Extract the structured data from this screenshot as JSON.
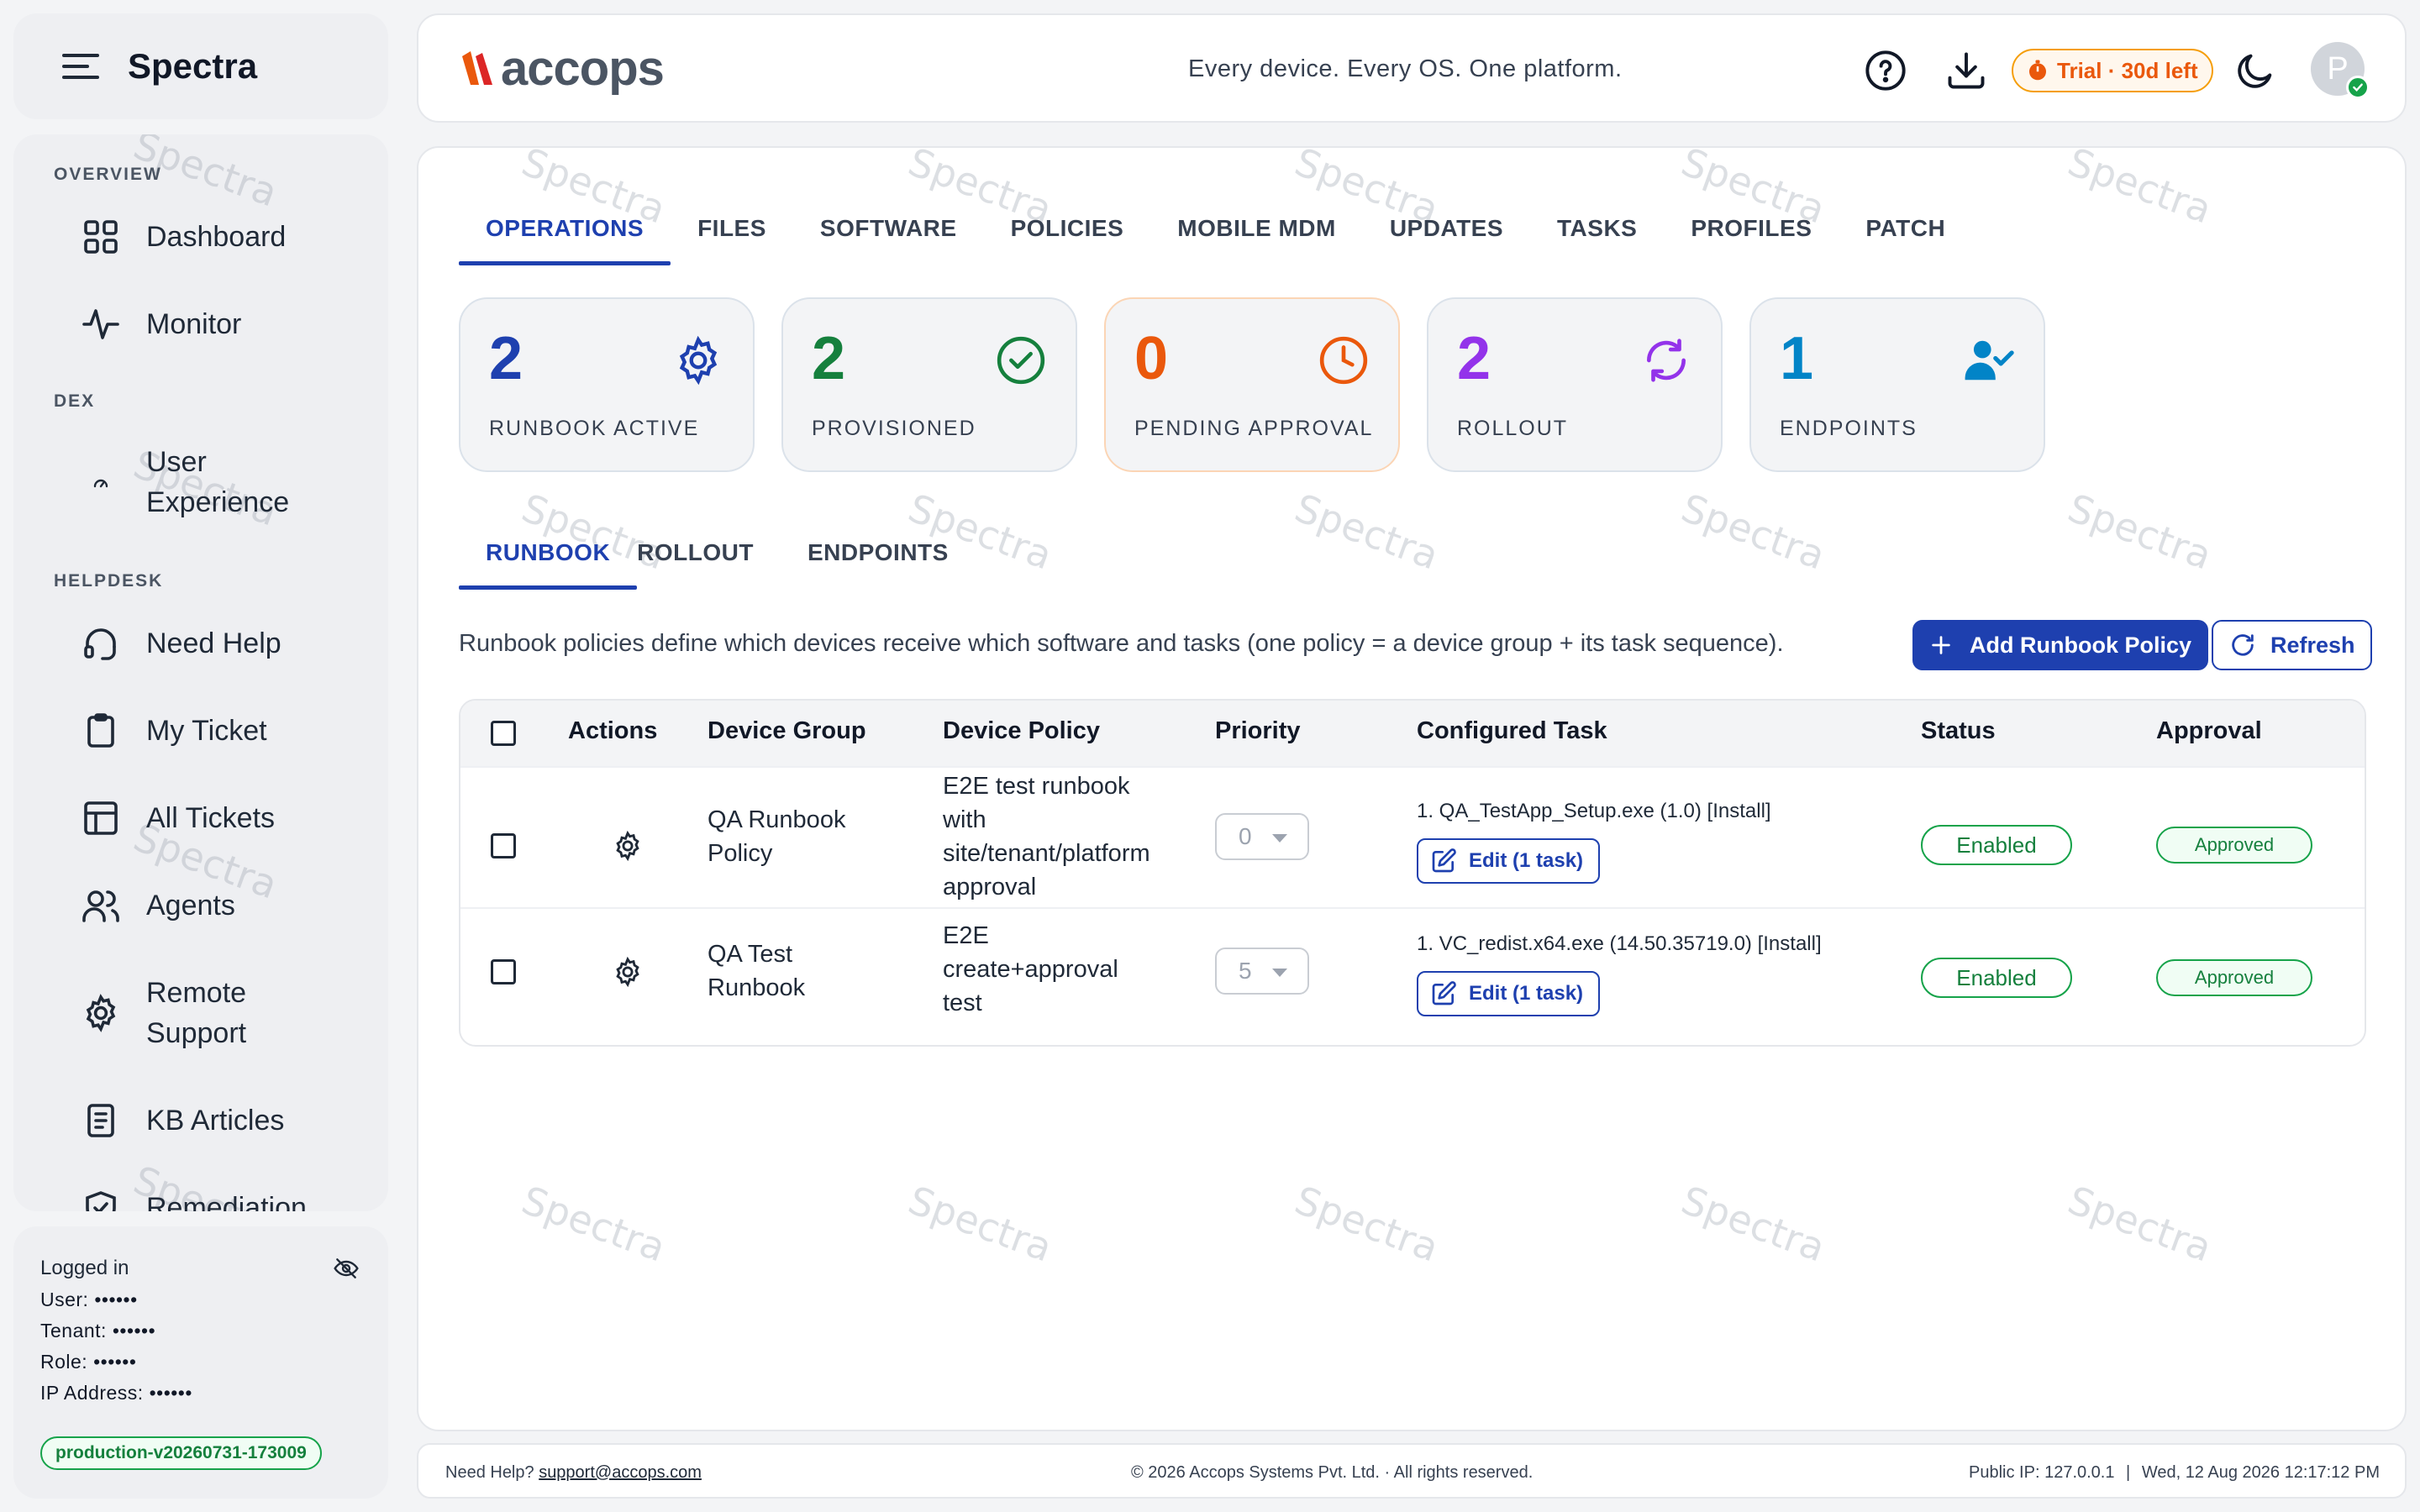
{
  "sidebar": {
    "brand": "Spectra",
    "sections": {
      "overview": "OVERVIEW",
      "dex": "DEX",
      "helpdesk": "HELPDESK"
    },
    "items": {
      "dashboard": "Dashboard",
      "monitor": "Monitor",
      "user_experience_1": "User",
      "user_experience_2": "Experience",
      "need_help": "Need Help",
      "my_ticket": "My Ticket",
      "all_tickets": "All Tickets",
      "agents": "Agents",
      "remote_support_1": "Remote",
      "remote_support_2": "Support",
      "kb_articles": "KB Articles",
      "remediation": "Remediation"
    },
    "login": {
      "title": "Logged in",
      "user": "User: ••••••",
      "tenant": "Tenant: ••••••",
      "role": "Role: ••••••",
      "ip": "IP Address: ••••••",
      "version": "production-v20260731-173009"
    }
  },
  "header": {
    "logo_text": "accops",
    "tagline": "Every device. Every OS. One platform.",
    "trial": "Trial · 30d left",
    "avatar_initial": "P"
  },
  "watermark": "Spectra",
  "tabs": [
    "OPERATIONS",
    "FILES",
    "SOFTWARE",
    "POLICIES",
    "MOBILE MDM",
    "UPDATES",
    "TASKS",
    "PROFILES",
    "PATCH"
  ],
  "stats": [
    {
      "value": "2",
      "label": "RUNBOOK ACTIVE",
      "color": "#1e40af",
      "icon": "gear-icon"
    },
    {
      "value": "2",
      "label": "PROVISIONED",
      "color": "#15803d",
      "icon": "check-circle-icon"
    },
    {
      "value": "0",
      "label": "PENDING APPROVAL",
      "color": "#ea580c",
      "icon": "clock-icon"
    },
    {
      "value": "2",
      "label": "ROLLOUT",
      "color": "#9333ea",
      "icon": "sync-icon"
    },
    {
      "value": "1",
      "label": "ENDPOINTS",
      "color": "#0284c7",
      "icon": "user-check-icon"
    }
  ],
  "subtabs": [
    "RUNBOOK",
    "ROLLOUT",
    "ENDPOINTS"
  ],
  "description": "Runbook policies define which devices receive which software and tasks (one policy = a device group + its task sequence).",
  "buttons": {
    "add": "Add Runbook Policy",
    "refresh": "Refresh"
  },
  "table": {
    "headers": [
      "Actions",
      "Device Group",
      "Device Policy",
      "Priority",
      "Configured Task",
      "Status",
      "Approval"
    ],
    "rows": [
      {
        "group_1": "QA Runbook",
        "group_2": "Policy",
        "policy_1": "E2E test runbook",
        "policy_2": "with",
        "policy_3": "site/tenant/platform",
        "policy_4": "approval",
        "priority": "0",
        "task": "1. QA_TestApp_Setup.exe (1.0) [Install]",
        "edit": "Edit (1 task)",
        "status": "Enabled",
        "approval": "Approved"
      },
      {
        "group_1": "QA Test",
        "group_2": "Runbook",
        "policy_1": "E2E",
        "policy_2": "create+approval",
        "policy_3": "test",
        "priority": "5",
        "task": "1. VC_redist.x64.exe (14.50.35719.0) [Install]",
        "edit": "Edit (1 task)",
        "status": "Enabled",
        "approval": "Approved"
      }
    ]
  },
  "footer": {
    "help_prefix": "Need Help?",
    "help_email": "support@accops.com",
    "copyright": "© 2026 Accops Systems Pvt. Ltd. · All rights reserved.",
    "ip": "Public IP: 127.0.0.1",
    "datetime": "Wed, 12 Aug 2026 12:17:12 PM"
  }
}
